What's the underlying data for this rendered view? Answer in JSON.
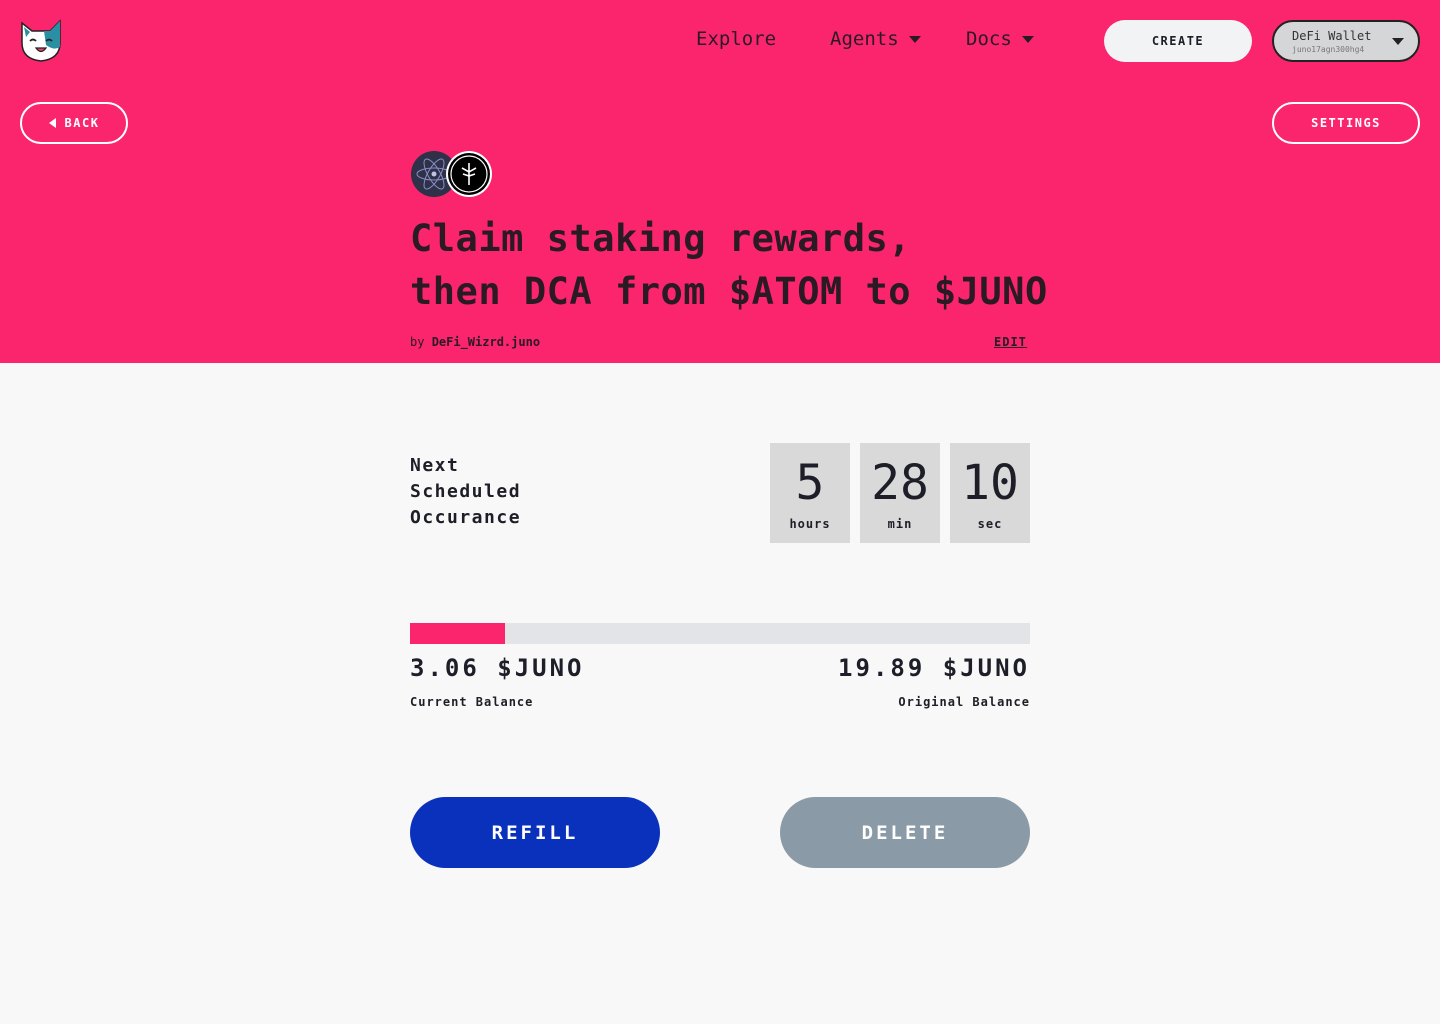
{
  "colors": {
    "brand": "#fb256e",
    "refill": "#0a31bb",
    "delete": "#8a9aa6",
    "timer_box": "#d9d9d9"
  },
  "header": {
    "logo_icon": "cat-logo-icon",
    "nav": {
      "explore": "Explore",
      "agents": "Agents",
      "docs": "Docs"
    },
    "create_label": "CREATE",
    "wallet": {
      "name": "DeFi Wallet",
      "address": "juno17agn300hg4"
    }
  },
  "actions": {
    "back_label": "BACK",
    "settings_label": "SETTINGS"
  },
  "agent": {
    "coin_icons": [
      "atom-icon",
      "juno-icon"
    ],
    "title_line1": "Claim staking rewards,",
    "title_line2": "then DCA from $ATOM to $JUNO",
    "by_prefix": "by",
    "author": "DeFi_Wizrd.juno",
    "edit_label": "EDIT"
  },
  "schedule": {
    "label_lines": [
      "Next",
      "Scheduled",
      "Occurance"
    ],
    "timer": [
      {
        "value": "5",
        "unit": "hours"
      },
      {
        "value": "28",
        "unit": "min"
      },
      {
        "value": "10",
        "unit": "sec"
      }
    ]
  },
  "balance": {
    "progress_fraction": 0.154,
    "current_amount": "3.06 $JUNO",
    "current_label": "Current Balance",
    "original_amount": "19.89 $JUNO",
    "original_label": "Original Balance"
  },
  "buttons": {
    "refill": "REFILL",
    "delete": "DELETE"
  }
}
